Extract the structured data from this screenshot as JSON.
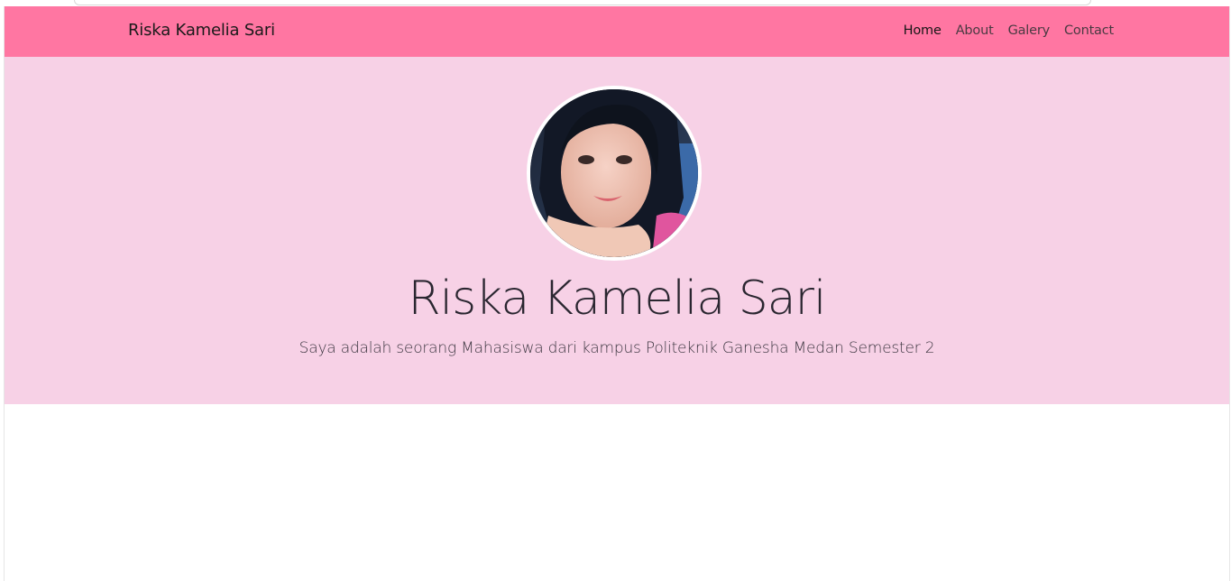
{
  "navbar": {
    "brand": "Riska Kamelia Sari",
    "links": [
      {
        "label": "Home",
        "active": true
      },
      {
        "label": "About",
        "active": false
      },
      {
        "label": "Galery",
        "active": false
      },
      {
        "label": "Contact",
        "active": false
      }
    ]
  },
  "hero": {
    "title": "Riska Kamelia Sari",
    "subtitle": "Saya adalah seorang Mahasiswa dari kampus Politeknik Ganesha Medan Semester 2"
  },
  "colors": {
    "navbar_bg": "#ff76a2",
    "hero_bg": "#f7d1e6"
  }
}
